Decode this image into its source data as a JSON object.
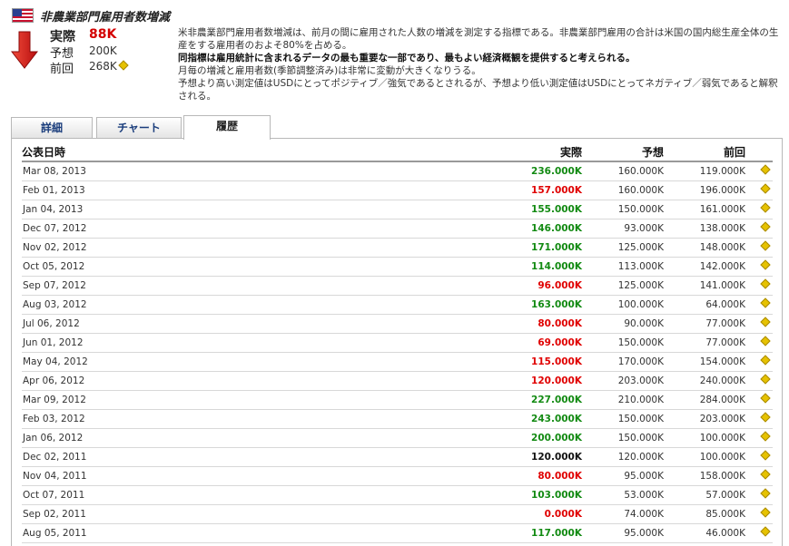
{
  "header": {
    "title": "非農業部門雇用者数増減",
    "stats": {
      "actual_label": "実際",
      "actual_value": "88K",
      "forecast_label": "予想",
      "forecast_value": "200K",
      "previous_label": "前回",
      "previous_value": "268K"
    },
    "description": {
      "line1": "米非農業部門雇用者数増減は、前月の間に雇用された人数の増減を測定する指標である。非農業部門雇用の合計は米国の国内総生産全体の生産をする雇用者のおよそ80%を占める。",
      "line2_bold": "同指標は雇用統計に含まれるデータの最も重要な一部であり、最もよい経済概観を提供すると考えられる。",
      "line3": "月毎の増減と雇用者数(季節調整済み)は非常に変動が大きくなりうる。",
      "line4": "予想より高い測定値はUSDにとってポジティブ／強気であるとされるが、予想より低い測定値はUSDにとってネガティブ／弱気であると解釈される。"
    }
  },
  "colors": {
    "up": "#128a12",
    "down": "#e00000",
    "neutral": "#111111",
    "arrow": "#d42020"
  },
  "tabs": [
    {
      "label": "詳細",
      "active": false
    },
    {
      "label": "チャート",
      "active": false
    },
    {
      "label": "履歴",
      "active": true
    }
  ],
  "table": {
    "columns": [
      "公表日時",
      "実際",
      "予想",
      "前回"
    ],
    "rows": [
      {
        "date": "Mar 08, 2013",
        "actual": "236.000K",
        "forecast": "160.000K",
        "previous": "119.000K",
        "trend": "up"
      },
      {
        "date": "Feb 01, 2013",
        "actual": "157.000K",
        "forecast": "160.000K",
        "previous": "196.000K",
        "trend": "down"
      },
      {
        "date": "Jan 04, 2013",
        "actual": "155.000K",
        "forecast": "150.000K",
        "previous": "161.000K",
        "trend": "up"
      },
      {
        "date": "Dec 07, 2012",
        "actual": "146.000K",
        "forecast": "93.000K",
        "previous": "138.000K",
        "trend": "up"
      },
      {
        "date": "Nov 02, 2012",
        "actual": "171.000K",
        "forecast": "125.000K",
        "previous": "148.000K",
        "trend": "up"
      },
      {
        "date": "Oct 05, 2012",
        "actual": "114.000K",
        "forecast": "113.000K",
        "previous": "142.000K",
        "trend": "up"
      },
      {
        "date": "Sep 07, 2012",
        "actual": "96.000K",
        "forecast": "125.000K",
        "previous": "141.000K",
        "trend": "down"
      },
      {
        "date": "Aug 03, 2012",
        "actual": "163.000K",
        "forecast": "100.000K",
        "previous": "64.000K",
        "trend": "up"
      },
      {
        "date": "Jul 06, 2012",
        "actual": "80.000K",
        "forecast": "90.000K",
        "previous": "77.000K",
        "trend": "down"
      },
      {
        "date": "Jun 01, 2012",
        "actual": "69.000K",
        "forecast": "150.000K",
        "previous": "77.000K",
        "trend": "down"
      },
      {
        "date": "May 04, 2012",
        "actual": "115.000K",
        "forecast": "170.000K",
        "previous": "154.000K",
        "trend": "down"
      },
      {
        "date": "Apr 06, 2012",
        "actual": "120.000K",
        "forecast": "203.000K",
        "previous": "240.000K",
        "trend": "down"
      },
      {
        "date": "Mar 09, 2012",
        "actual": "227.000K",
        "forecast": "210.000K",
        "previous": "284.000K",
        "trend": "up"
      },
      {
        "date": "Feb 03, 2012",
        "actual": "243.000K",
        "forecast": "150.000K",
        "previous": "203.000K",
        "trend": "up"
      },
      {
        "date": "Jan 06, 2012",
        "actual": "200.000K",
        "forecast": "150.000K",
        "previous": "100.000K",
        "trend": "up"
      },
      {
        "date": "Dec 02, 2011",
        "actual": "120.000K",
        "forecast": "120.000K",
        "previous": "100.000K",
        "trend": "same"
      },
      {
        "date": "Nov 04, 2011",
        "actual": "80.000K",
        "forecast": "95.000K",
        "previous": "158.000K",
        "trend": "down"
      },
      {
        "date": "Oct 07, 2011",
        "actual": "103.000K",
        "forecast": "53.000K",
        "previous": "57.000K",
        "trend": "up"
      },
      {
        "date": "Sep 02, 2011",
        "actual": "0.000K",
        "forecast": "74.000K",
        "previous": "85.000K",
        "trend": "down"
      },
      {
        "date": "Aug 05, 2011",
        "actual": "117.000K",
        "forecast": "95.000K",
        "previous": "46.000K",
        "trend": "up"
      }
    ]
  }
}
